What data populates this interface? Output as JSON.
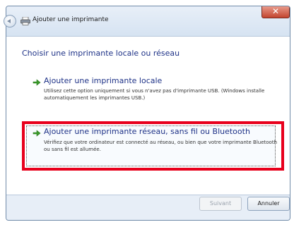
{
  "window": {
    "title": "Ajouter une imprimante",
    "close_glyph": "✕"
  },
  "page": {
    "heading": "Choisir une imprimante locale ou réseau"
  },
  "options": [
    {
      "title": "Ajouter une imprimante locale",
      "description": "Utilisez cette option uniquement si vous n'avez pas d'imprimante USB. (Windows installe automatiquement les imprimantes USB.)"
    },
    {
      "title": "Ajouter une imprimante réseau, sans fil ou Bluetooth",
      "description": "Vérifiez que votre ordinateur est connecté au réseau, ou bien que votre imprimante Bluetooth ou sans fil est allumée."
    }
  ],
  "buttons": {
    "next": "Suivant",
    "cancel": "Annuler"
  },
  "colors": {
    "highlight": "#e8001c",
    "link_blue": "#1e3287",
    "arrow_green": "#3a9a2a"
  }
}
